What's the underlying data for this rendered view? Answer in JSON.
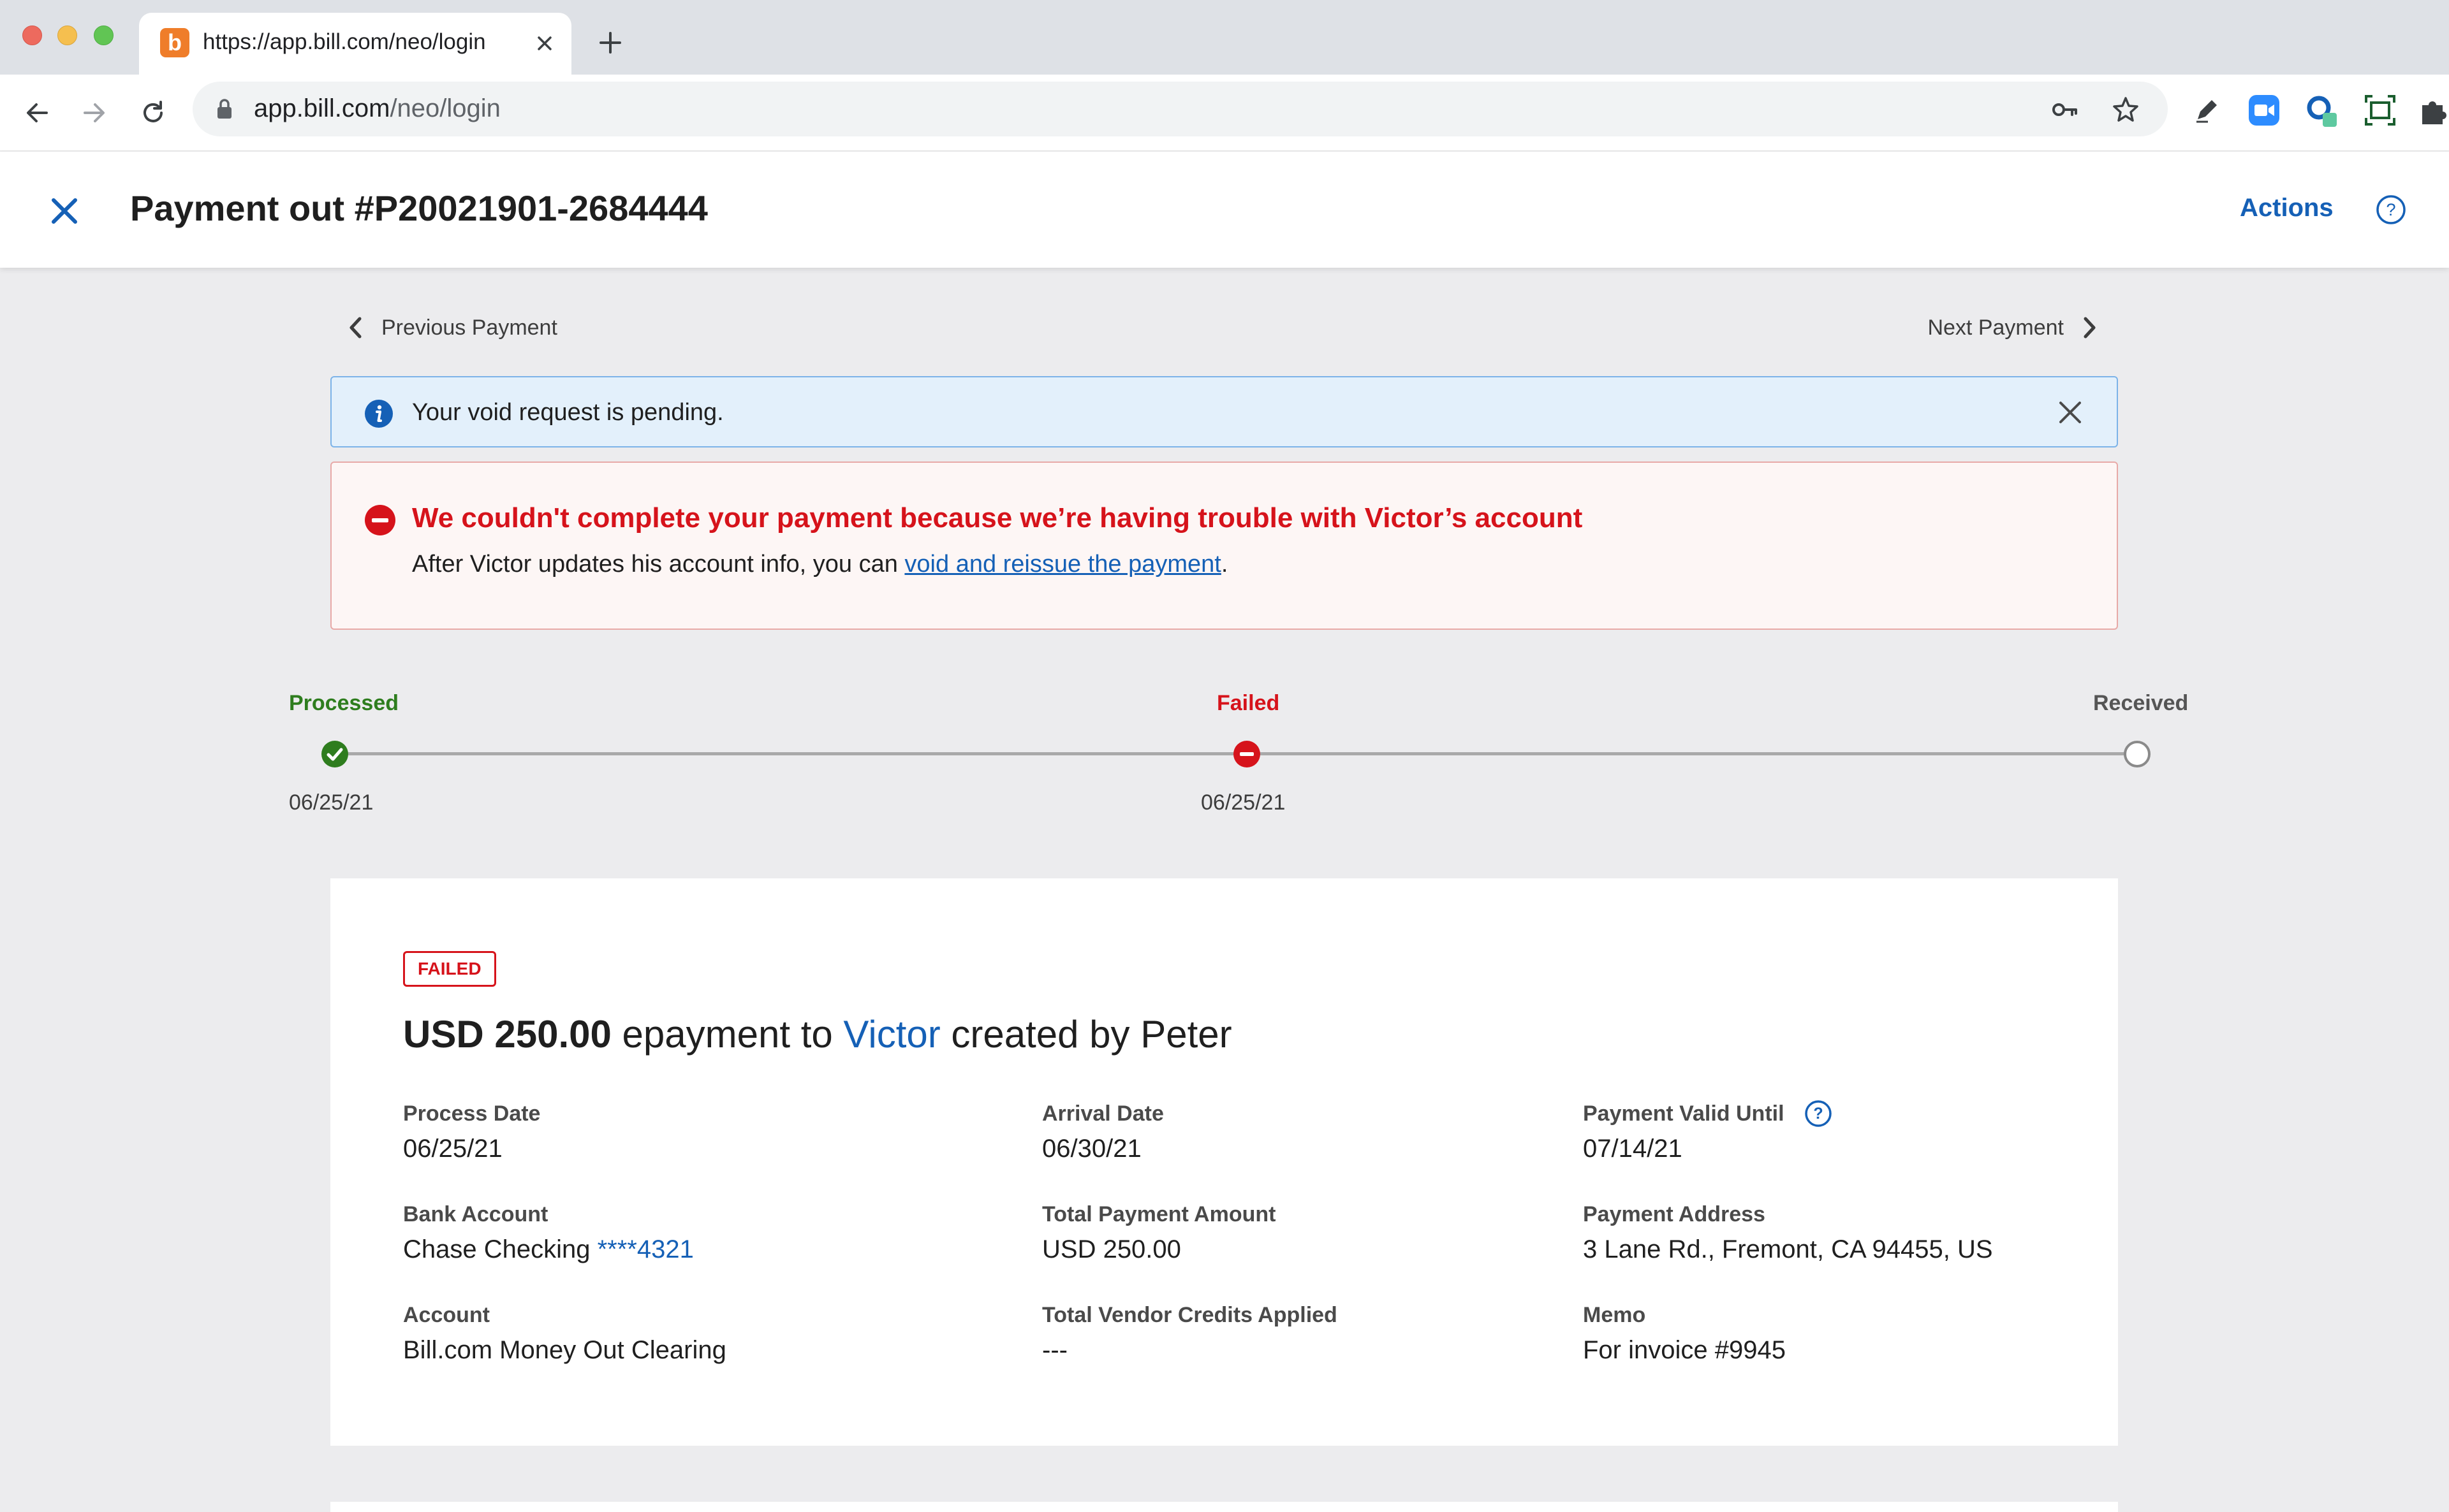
{
  "browser": {
    "tab_title": "https://app.bill.com/neo/login",
    "favicon_letter": "b",
    "url_host": "app.bill.com",
    "url_path": "/neo/login"
  },
  "header": {
    "title": "Payment out #P20021901-2684444",
    "actions_label": "Actions"
  },
  "pager": {
    "prev_label": "Previous Payment",
    "next_label": "Next Payment"
  },
  "info_banner": {
    "text": "Your void request is pending."
  },
  "error_banner": {
    "title": "We couldn't complete your payment because we’re having trouble with Victor’s account",
    "body_prefix": "After Victor updates his account info, you can ",
    "link_text": "void and reissue the payment",
    "body_suffix": "."
  },
  "timeline": {
    "steps": [
      {
        "label": "Processed",
        "date": "06/25/21",
        "status": "complete",
        "color": "#2e7d1e"
      },
      {
        "label": "Failed",
        "date": "06/25/21",
        "status": "failed",
        "color": "#d6131b"
      },
      {
        "label": "Received",
        "date": "",
        "status": "pending",
        "color": "#555555"
      }
    ]
  },
  "payment": {
    "status_badge": "FAILED",
    "amount": "USD 250.00",
    "method_text": " epayment to ",
    "vendor": "Victor",
    "creator_text": " created by Peter",
    "fields": {
      "process_date": {
        "label": "Process Date",
        "value": "06/25/21"
      },
      "arrival_date": {
        "label": "Arrival Date",
        "value": "06/30/21"
      },
      "valid_until": {
        "label": "Payment Valid Until",
        "value": "07/14/21"
      },
      "bank_account": {
        "label": "Bank Account",
        "value": "Chase Checking ",
        "account_suffix": "****4321"
      },
      "total_amount": {
        "label": "Total Payment Amount",
        "value": "USD 250.00"
      },
      "payment_address": {
        "label": "Payment Address",
        "value": "3 Lane Rd., Fremont, CA 94455, US"
      },
      "account": {
        "label": "Account",
        "value": "Bill.com Money Out Clearing"
      },
      "vendor_credits": {
        "label": "Total Vendor Credits Applied",
        "value": "---"
      },
      "memo": {
        "label": "Memo",
        "value": "For invoice #9945"
      }
    }
  },
  "colors": {
    "accent_blue": "#1560b6",
    "error_red": "#d6131b",
    "success_green": "#2e7d1e"
  }
}
